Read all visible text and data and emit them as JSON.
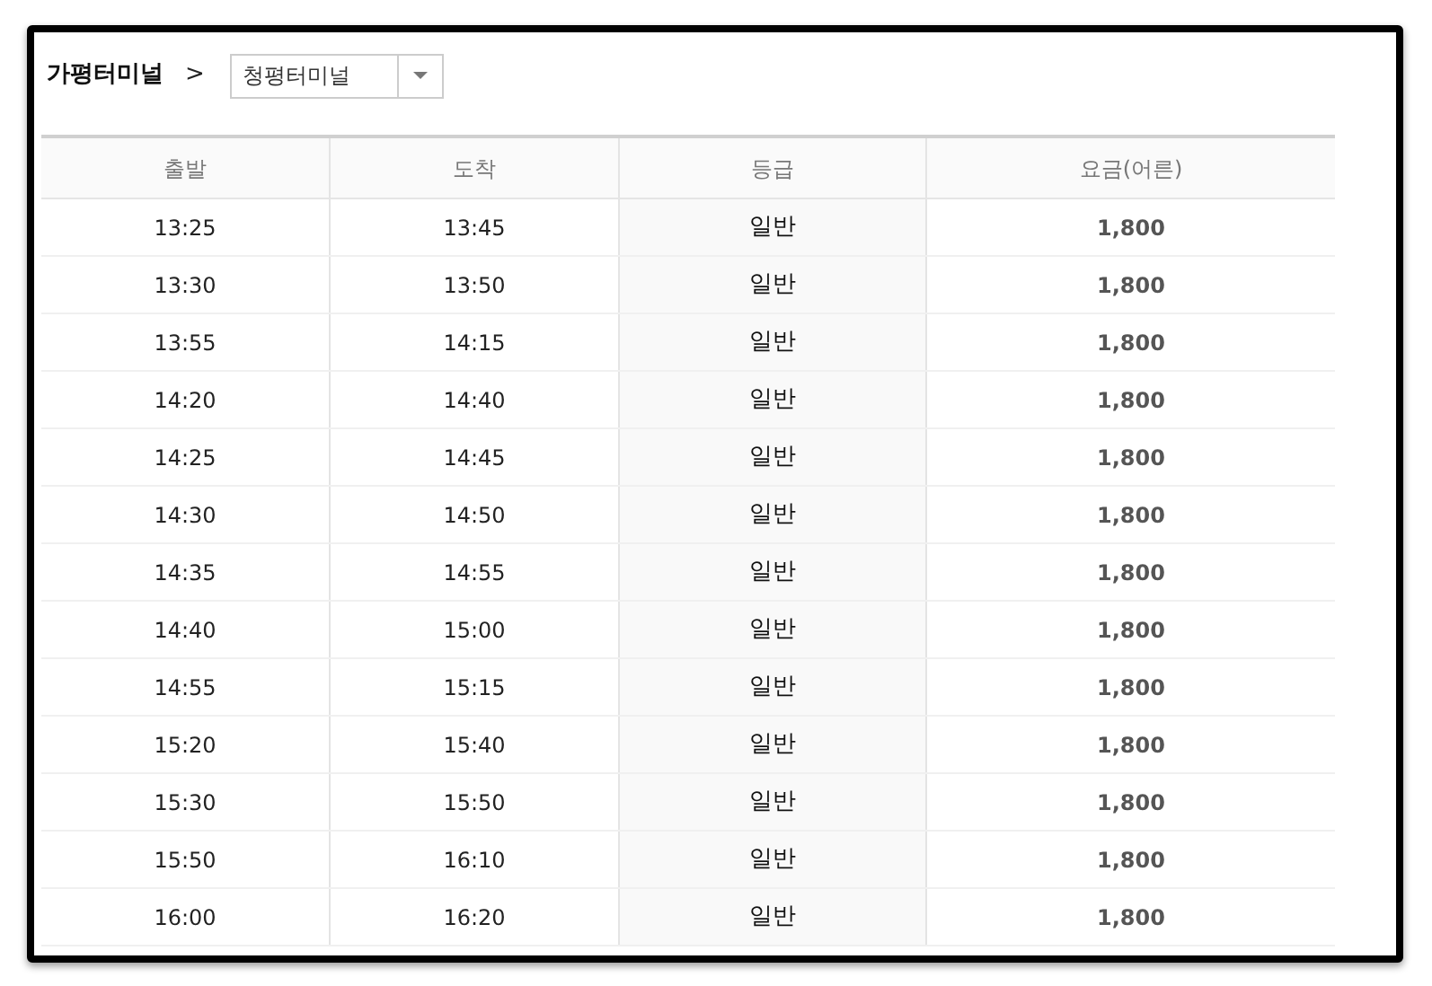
{
  "breadcrumb": {
    "origin": "가평터미널",
    "separator": ">",
    "destination": {
      "value": "청평터미널"
    }
  },
  "table": {
    "columns": [
      "출발",
      "도착",
      "등급",
      "요금(어른)"
    ],
    "rows": [
      [
        "13:25",
        "13:45",
        "일반",
        "1,800"
      ],
      [
        "13:30",
        "13:50",
        "일반",
        "1,800"
      ],
      [
        "13:55",
        "14:15",
        "일반",
        "1,800"
      ],
      [
        "14:20",
        "14:40",
        "일반",
        "1,800"
      ],
      [
        "14:25",
        "14:45",
        "일반",
        "1,800"
      ],
      [
        "14:30",
        "14:50",
        "일반",
        "1,800"
      ],
      [
        "14:35",
        "14:55",
        "일반",
        "1,800"
      ],
      [
        "14:40",
        "15:00",
        "일반",
        "1,800"
      ],
      [
        "14:55",
        "15:15",
        "일반",
        "1,800"
      ],
      [
        "15:20",
        "15:40",
        "일반",
        "1,800"
      ],
      [
        "15:30",
        "15:50",
        "일반",
        "1,800"
      ],
      [
        "15:50",
        "16:10",
        "일반",
        "1,800"
      ],
      [
        "16:00",
        "16:20",
        "일반",
        "1,800"
      ]
    ]
  }
}
